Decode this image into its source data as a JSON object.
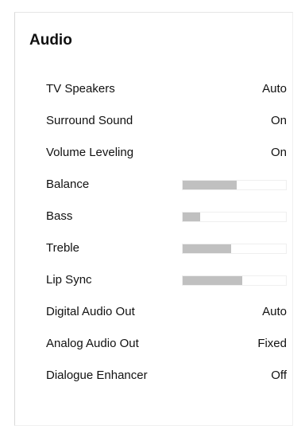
{
  "title": "Audio",
  "items": [
    {
      "label": "TV Speakers",
      "type": "value",
      "value": "Auto"
    },
    {
      "label": "Surround Sound",
      "type": "value",
      "value": "On"
    },
    {
      "label": "Volume Leveling",
      "type": "value",
      "value": "On"
    },
    {
      "label": "Balance",
      "type": "slider",
      "level": 0.52
    },
    {
      "label": "Bass",
      "type": "slider",
      "level": 0.17
    },
    {
      "label": "Treble",
      "type": "slider",
      "level": 0.47
    },
    {
      "label": "Lip Sync",
      "type": "slider",
      "level": 0.58
    },
    {
      "label": "Digital Audio Out",
      "type": "value",
      "value": "Auto"
    },
    {
      "label": "Analog Audio Out",
      "type": "value",
      "value": "Fixed"
    },
    {
      "label": "Dialogue Enhancer",
      "type": "value",
      "value": "Off"
    }
  ],
  "colors": {
    "background": "#ffffff",
    "text": "#111111",
    "slider_fill": "#c0c0c0",
    "slider_track": "#ffffff"
  }
}
